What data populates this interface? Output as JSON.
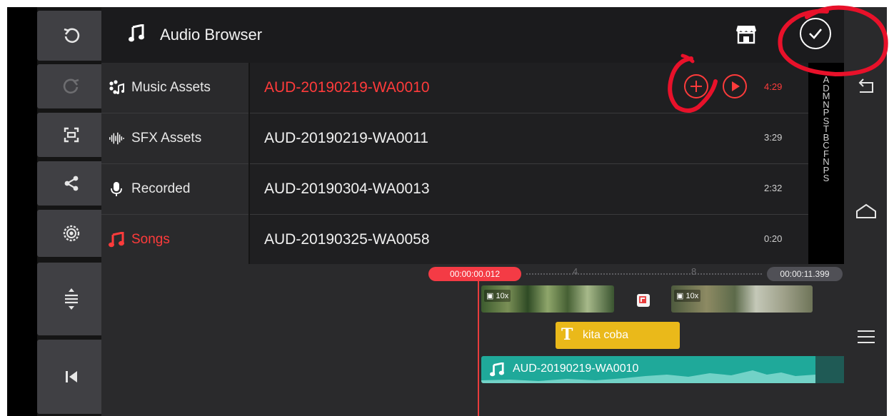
{
  "header": {
    "title": "Audio Browser"
  },
  "categories": [
    {
      "label": "Music Assets",
      "icon": "music-assets-icon",
      "selected": false
    },
    {
      "label": "SFX Assets",
      "icon": "waveform-icon",
      "selected": false
    },
    {
      "label": "Recorded",
      "icon": "microphone-icon",
      "selected": false
    },
    {
      "label": "Songs",
      "icon": "music-note-icon",
      "selected": true
    }
  ],
  "files": [
    {
      "name": "AUD-20190219-WA0010",
      "duration": "4:29",
      "selected": true
    },
    {
      "name": "AUD-20190219-WA0011",
      "duration": "3:29",
      "selected": false
    },
    {
      "name": "AUD-20190304-WA0013",
      "duration": "2:32",
      "selected": false
    },
    {
      "name": "AUD-20190325-WA0058",
      "duration": "0:20",
      "selected": false
    }
  ],
  "alphabet_index": [
    "A",
    "D",
    "M",
    "N",
    "P",
    "S",
    "T",
    "B",
    "C",
    "F",
    "N",
    "P",
    "S"
  ],
  "timeline": {
    "current_time": "00:00:00.012",
    "end_time": "00:00:11.399",
    "tick_4": "4",
    "tick_8": "8",
    "clip1_speed": "10x",
    "clip2_speed": "10x",
    "text_clip_label": "kita coba",
    "audio_clip_label": "AUD-20190219-WA0010"
  },
  "colors": {
    "accent": "#ff3b3b",
    "audio_track": "#1fa99a",
    "text_track": "#eab91a",
    "annotation": "#e8112a"
  }
}
